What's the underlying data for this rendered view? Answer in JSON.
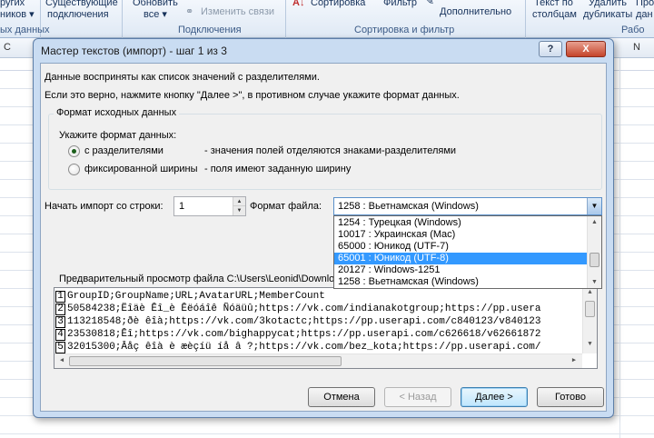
{
  "ribbon": {
    "btn1_line1": "ругих",
    "btn1_line2": "ников ▾",
    "btn2_line1": "Существующие",
    "btn2_line2": "подключения",
    "btn3_line1": "Обновить",
    "btn3_line2": "все ▾",
    "edit_links": "Изменить связи",
    "sort": "Сортировка",
    "filter": "Фильтр",
    "advanced": "Дополнительно",
    "text_to_cols_line1": "Текст по",
    "text_to_cols_line2": "столбцам",
    "remove_dup_line1": "Удалить",
    "remove_dup_line2": "дубликаты",
    "extra_line1": "Про",
    "extra_line2": "дан",
    "group_get_data": "ых данных",
    "group_connections": "Подключения",
    "group_sort_filter": "Сортировка и фильтр",
    "group_work": "Рабо"
  },
  "columns": {
    "left": "C",
    "right": "N"
  },
  "dialog": {
    "title": "Мастер текстов (импорт) - шаг 1 из 3",
    "help_btn": "?",
    "close_btn": "X",
    "intro_line1": "Данные восприняты как список значений с разделителями.",
    "intro_line2": "Если это верно, нажмите кнопку \"Далее >\", в противном случае укажите формат данных.",
    "group_label": "Формат исходных данных",
    "specify_label": "Укажите формат данных:",
    "radio1_label": "с разделителями",
    "radio1_desc": "- значения полей отделяются знаками-разделителями",
    "radio2_label": "фиксированной ширины",
    "radio2_desc": "- поля имеют заданную ширину",
    "start_row_label": "Начать импорт со строки:",
    "start_row_value": "1",
    "file_format_label": "Формат файла:",
    "file_format_value": "1258 : Вьетнамская (Windows)",
    "dropdown_items": [
      "1254 : Турецкая (Windows)",
      "10017 : Украинская (Mac)",
      "65000 : Юникод (UTF-7)",
      "65001 : Юникод (UTF-8)",
      "20127 : Windows-1251",
      "1258 : Вьетнамская (Windows)"
    ],
    "dropdown_selected_index": 3,
    "preview_label": "Предварительный просмотр файла C:\\Users\\Leonid\\Download",
    "preview_lines": [
      {
        "num": "1",
        "text": "GroupID;GroupName;URL;AvatarURL;MemberCount"
      },
      {
        "num": "2",
        "text": "50584238;Ëîäè Êî_è Êëóáîê Ñóäüû;https://vk.com/indianakotgroup;https://pp.usera"
      },
      {
        "num": "3",
        "text": "113218548;ðè êîà;https://vk.com/3kotactc;https://pp.userapi.com/c840123/v840123"
      },
      {
        "num": "4",
        "text": "23530818;Êî;https://vk.com/bighappycat;https://pp.userapi.com/c626618/v62661872"
      },
      {
        "num": "5",
        "text": "32015300;Âåç êîà è æèçíü íå â ?;https://vk.com/bez_kota;https://pp.userapi.com/"
      }
    ],
    "cancel_btn": "Отмена",
    "back_btn": "< Назад",
    "next_btn": "Далее >",
    "finish_btn": "Готово"
  }
}
